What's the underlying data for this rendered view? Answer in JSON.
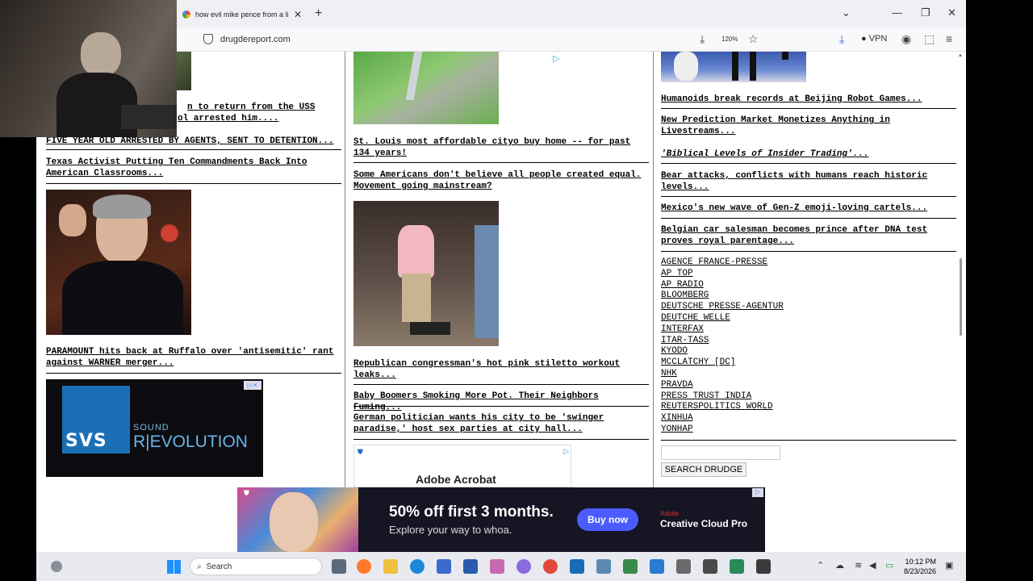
{
  "browser": {
    "tab_title": "how evil mike pence from a libe",
    "url": "drugdereport.com",
    "zoom": "120%",
    "vpn_label": "VPN"
  },
  "left_column": {
    "partial_headline_1": "n to return from the USS",
    "partial_headline_2": "ol arrested him....",
    "headlines": [
      "FIVE YEAR OLD ARRESTED BY AGENTS, SENT TO DETENTION...",
      "Texas Activist Putting Ten Commandments Back Into American Classrooms..."
    ],
    "photo_headline": "PARAMOUNT hits back at Ruffalo over 'antisemitic' rant against WARNER merger...",
    "ad": {
      "brand": "SVS",
      "tagline_top": "SOUND",
      "tagline": "R|EVOLUTION"
    }
  },
  "middle_column": {
    "headlines": [
      "St. Louis most affordable cityo buy home -- for past 134 years!",
      "Some Americans don't believe all people created equal. Movement going mainstream?"
    ],
    "photo_headlines": [
      "Republican congressman's hot pink stiletto workout leaks...",
      "Baby Boomers Smoking More Pot. Their Neighbors Fuming...",
      "German politician wants his city to be 'swinger paradise,' host sex parties at city hall..."
    ],
    "ad_brand": "Adobe Acrobat"
  },
  "right_column": {
    "headlines": [
      "Humanoids break records at Beijing Robot Games...",
      "New Prediction Market Monetizes Anything in Livestreams...",
      "'Biblical Levels of Insider Trading'...",
      "Bear attacks, conflicts with humans reach historic levels...",
      "Mexico's new wave of Gen-Z emoji-loving cartels...",
      "Belgian car salesman becomes prince after DNA test proves royal parentage..."
    ],
    "wire_links": [
      "AGENCE FRANCE-PRESSE",
      "AP TOP",
      "AP RADIO",
      "BLOOMBERG",
      "DEUTSCHE PRESSE-AGENTUR",
      "DEUTCHE WELLE",
      "INTERFAX",
      "ITAR-TASS",
      "KYODO",
      "MCCLATCHY [DC]",
      "NHK",
      "PRAVDA",
      "PRESS TRUST INDIA",
      "REUTERSPOLITICS WORLD",
      "XINHUA",
      "YONHAP"
    ],
    "search_button": "SEARCH DRUDGE"
  },
  "bottom_ad": {
    "headline": "50% off first 3 months.",
    "subline": "Explore your way to whoa.",
    "cta": "Buy now",
    "brand": "Creative Cloud Pro",
    "brand_top": "Adobe"
  },
  "taskbar": {
    "search_placeholder": "Search",
    "time": "10:12 PM",
    "date": "8/23/2026"
  },
  "colors": {
    "cta_blue": "#4a5cff",
    "svs_blue": "#1b6fb5"
  }
}
